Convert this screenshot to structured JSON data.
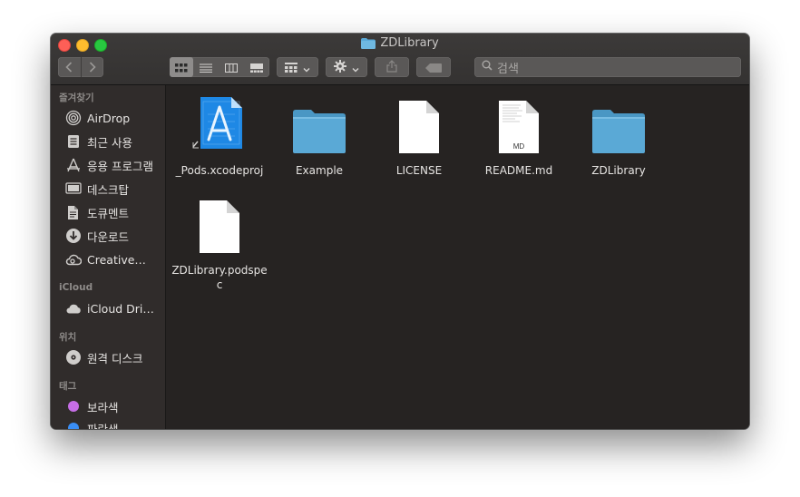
{
  "window": {
    "title": "ZDLibrary"
  },
  "toolbar": {
    "search_placeholder": "검색"
  },
  "sidebar": {
    "sections": [
      {
        "title": "즐겨찾기"
      },
      {
        "title": "iCloud"
      },
      {
        "title": "위치"
      },
      {
        "title": "태그"
      }
    ],
    "favorites": [
      {
        "label": "AirDrop",
        "icon": "airdrop-icon"
      },
      {
        "label": "최근 사용",
        "icon": "recents-icon"
      },
      {
        "label": "응용 프로그램",
        "icon": "applications-icon"
      },
      {
        "label": "데스크탑",
        "icon": "desktop-icon"
      },
      {
        "label": "도큐멘트",
        "icon": "documents-icon"
      },
      {
        "label": "다운로드",
        "icon": "downloads-icon"
      },
      {
        "label": "Creative…",
        "icon": "creative-cloud-icon"
      }
    ],
    "icloud": [
      {
        "label": "iCloud Dri…",
        "icon": "cloud-icon"
      }
    ],
    "locations": [
      {
        "label": "원격 디스크",
        "icon": "remote-disc-icon"
      }
    ],
    "tags": [
      {
        "label": "보라색",
        "color": "#c66ee6"
      },
      {
        "label": "파란색",
        "color": "#3a8ef5"
      }
    ]
  },
  "files": [
    {
      "name": "_Pods.xcodeproj",
      "type": "xcodeproj"
    },
    {
      "name": "Example",
      "type": "folder"
    },
    {
      "name": "LICENSE",
      "type": "document"
    },
    {
      "name": "README.md",
      "type": "markdown",
      "badge": "MD"
    },
    {
      "name": "ZDLibrary",
      "type": "folder"
    },
    {
      "name": "ZDLibrary.podspec",
      "type": "document"
    }
  ],
  "colors": {
    "folder": "#5aa9d6",
    "folder_tab": "#4a97c4",
    "xcode_blue": "#1e88e5"
  }
}
